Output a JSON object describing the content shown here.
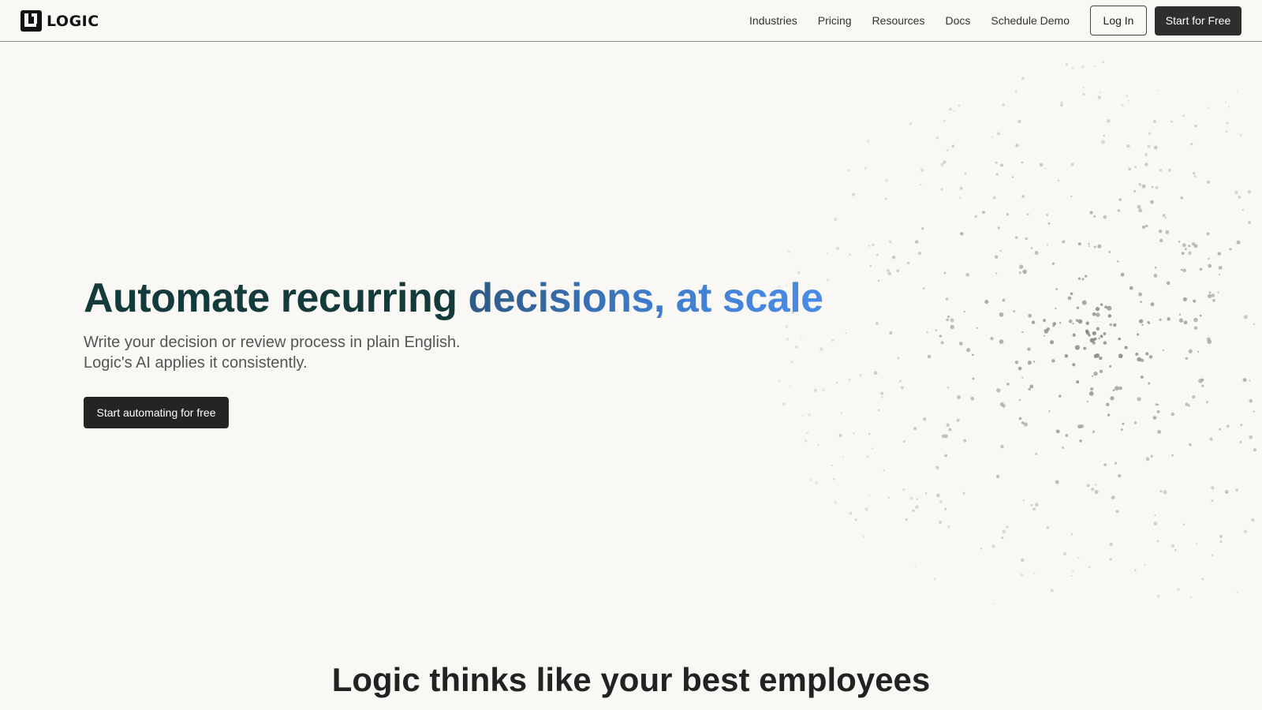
{
  "header": {
    "logo_text": "LOGIC",
    "nav": [
      "Industries",
      "Pricing",
      "Resources",
      "Docs",
      "Schedule Demo"
    ],
    "login_label": "Log In",
    "start_label": "Start for Free"
  },
  "hero": {
    "title_dark": "Automate recurring ",
    "title_accent": "decisions, at scale",
    "subtitle_line1": "Write your decision or review process in plain English.",
    "subtitle_line2": "Logic's AI applies it consistently.",
    "cta_label": "Start automating for free"
  },
  "section": {
    "title": "Logic thinks like your best employees",
    "subtitle": ""
  },
  "colors": {
    "background": "#f9f8f4",
    "title_dark": "#143b3b",
    "accent_start": "#2e5a84",
    "accent_end": "#4a8be8",
    "button_dark": "#2e2e2e"
  },
  "icons": {
    "logo": "logic-logo-icon"
  }
}
